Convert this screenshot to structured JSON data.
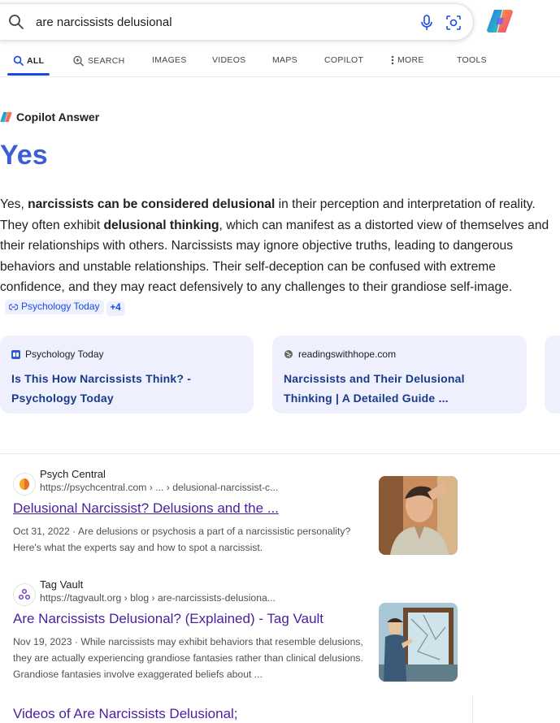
{
  "search": {
    "query": "are narcissists delusional"
  },
  "tabs": [
    {
      "label": "ALL"
    },
    {
      "label": "SEARCH"
    },
    {
      "label": "IMAGES"
    },
    {
      "label": "VIDEOS"
    },
    {
      "label": "MAPS"
    },
    {
      "label": "COPILOT"
    },
    {
      "label": "MORE"
    },
    {
      "label": "TOOLS"
    }
  ],
  "answer": {
    "header": "Copilot Answer",
    "headline": "Yes",
    "p1": "Yes, ",
    "b1": "narcissists can be considered delusional",
    "p2": " in their perception and interpretation of reality. They often exhibit ",
    "b2": "delusional thinking",
    "p3": ", which can manifest as a distorted view of themselves and their relationships with others. Narcissists may ignore objective truths, leading to dangerous behaviors and unstable relationships. Their self-deception can be confused with extreme confidence, and they may react defensively to any challenges to their grandiose self-image.",
    "cite": "Psychology Today",
    "cite_more": "+4"
  },
  "cards": [
    {
      "source": "Psychology Today",
      "title": "Is This How Narcissists Think? - Psychology Today"
    },
    {
      "source": "readingswithhope.com",
      "title": "Narcissists and Their Delusional Thinking | A Detailed Guide ..."
    }
  ],
  "results": [
    {
      "site": "Psych Central",
      "url": "https://psychcentral.com › ... › delusional-narcissist-c...",
      "title": "Delusional Narcissist? Delusions and the ...",
      "snippet": "Oct 31, 2022 · Are delusions or psychosis a part of a narcissistic personality? Here's what the experts say and how to spot a narcissist."
    },
    {
      "site": "Tag Vault",
      "url": "https://tagvault.org › blog › are-narcissists-delusiona...",
      "title": "Are Narcissists Delusional? (Explained) - Tag Vault",
      "snippet": "Nov 19, 2023 · While narcissists may exhibit behaviors that resemble delusions, they are actually experiencing grandiose fantasies rather than clinical delusions. Grandiose fantasies involve exaggerated beliefs about ..."
    }
  ],
  "videos": {
    "title": "Videos of Are Narcissists Delusional;"
  },
  "colors": {
    "accent": "#174ae4",
    "link_visited": "#4a1ea0",
    "card_bg": "#eef1fd"
  }
}
